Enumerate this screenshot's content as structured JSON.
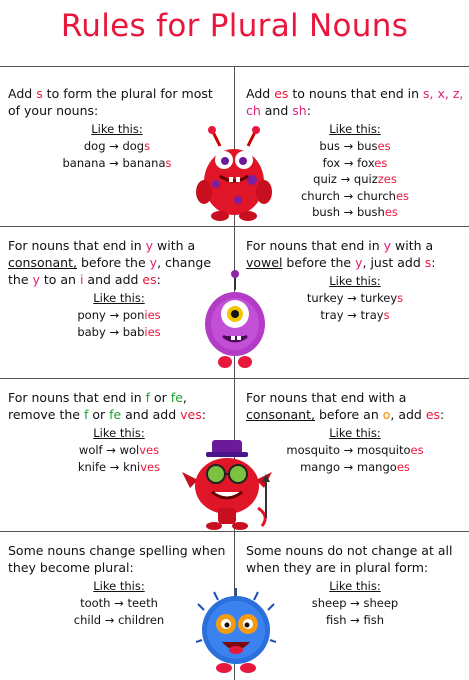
{
  "title": "Rules for Plural Nouns",
  "like_this": "Like this:",
  "arrow": "→",
  "rules": [
    {
      "intro": [
        {
          "t": "Add "
        },
        {
          "t": "s",
          "c": "red"
        },
        {
          "t": " to form the plural for most of your nouns:"
        }
      ],
      "examples": [
        {
          "base": "dog",
          "stem": "dog",
          "suffix": "s",
          "suffix_color": "red"
        },
        {
          "base": "banana",
          "stem": "banana",
          "suffix": "s",
          "suffix_color": "red"
        }
      ]
    },
    {
      "intro": [
        {
          "t": "Add "
        },
        {
          "t": "es",
          "c": "red"
        },
        {
          "t": " to nouns that end in "
        },
        {
          "t": "s, x, z, ch",
          "c": "pink"
        },
        {
          "t": " and "
        },
        {
          "t": "sh",
          "c": "pink"
        },
        {
          "t": ":"
        }
      ],
      "examples": [
        {
          "base": "bus",
          "stem": "bus",
          "suffix": "es",
          "suffix_color": "red"
        },
        {
          "base": "fox",
          "stem": "fox",
          "suffix": "es",
          "suffix_color": "red"
        },
        {
          "base": "quiz",
          "stem": "quiz",
          "suffix": "zes",
          "suffix_color": "red"
        },
        {
          "base": "church",
          "stem": "church",
          "suffix": "es",
          "suffix_color": "red"
        },
        {
          "base": "bush",
          "stem": "bush",
          "suffix": "es",
          "suffix_color": "red"
        }
      ]
    },
    {
      "intro": [
        {
          "t": "For nouns that end in "
        },
        {
          "t": "y",
          "c": "pink"
        },
        {
          "t": " with a "
        },
        {
          "t": "consonant,",
          "u": true
        },
        {
          "t": " before the "
        },
        {
          "t": "y",
          "c": "pink"
        },
        {
          "t": ", change the "
        },
        {
          "t": "y",
          "c": "pink"
        },
        {
          "t": " to an "
        },
        {
          "t": "i",
          "c": "pink"
        },
        {
          "t": " and add "
        },
        {
          "t": "es",
          "c": "red"
        },
        {
          "t": ":"
        }
      ],
      "examples": [
        {
          "base": "pony",
          "stem": "pon",
          "suffix": "ies",
          "suffix_color": "red"
        },
        {
          "base": "baby",
          "stem": "bab",
          "suffix": "ies",
          "suffix_color": "red"
        }
      ]
    },
    {
      "intro": [
        {
          "t": "For nouns that end in "
        },
        {
          "t": "y",
          "c": "pink"
        },
        {
          "t": " with a "
        },
        {
          "t": "vowel",
          "u": true
        },
        {
          "t": " before the "
        },
        {
          "t": "y",
          "c": "pink"
        },
        {
          "t": ", just add "
        },
        {
          "t": "s",
          "c": "red"
        },
        {
          "t": ":"
        }
      ],
      "examples": [
        {
          "base": "turkey",
          "stem": "turkey",
          "suffix": "s",
          "suffix_color": "red"
        },
        {
          "base": "tray",
          "stem": "tray",
          "suffix": "s",
          "suffix_color": "red"
        }
      ]
    },
    {
      "intro": [
        {
          "t": "For nouns that end in "
        },
        {
          "t": "f",
          "c": "green"
        },
        {
          "t": " or "
        },
        {
          "t": "fe",
          "c": "green"
        },
        {
          "t": ", remove the "
        },
        {
          "t": "f",
          "c": "green"
        },
        {
          "t": " or "
        },
        {
          "t": "fe",
          "c": "green"
        },
        {
          "t": " and add "
        },
        {
          "t": "ves",
          "c": "red"
        },
        {
          "t": ":"
        }
      ],
      "examples": [
        {
          "base": "wolf",
          "stem": "wol",
          "suffix": "ves",
          "suffix_color": "red"
        },
        {
          "base": "knife",
          "stem": "kni",
          "suffix": "ves",
          "suffix_color": "red"
        }
      ]
    },
    {
      "intro": [
        {
          "t": "For nouns that end with a "
        },
        {
          "t": "consonant,",
          "u": true
        },
        {
          "t": " before an "
        },
        {
          "t": "o",
          "c": "orange"
        },
        {
          "t": ", add "
        },
        {
          "t": "es",
          "c": "red"
        },
        {
          "t": ":"
        }
      ],
      "examples": [
        {
          "base": "mosquito",
          "stem": "mosquito",
          "suffix": "es",
          "suffix_color": "red"
        },
        {
          "base": "mango",
          "stem": "mango",
          "suffix": "es",
          "suffix_color": "red"
        }
      ]
    },
    {
      "intro": [
        {
          "t": "Some nouns change spelling when they become plural:"
        }
      ],
      "examples": [
        {
          "base": "tooth",
          "stem": "teeth",
          "suffix": "",
          "suffix_color": ""
        },
        {
          "base": "child",
          "stem": "children",
          "suffix": "",
          "suffix_color": ""
        }
      ]
    },
    {
      "intro": [
        {
          "t": "Some nouns do not change at all when they are in plural form:"
        }
      ],
      "examples": [
        {
          "base": "sheep",
          "stem": "sheep",
          "suffix": "",
          "suffix_color": ""
        },
        {
          "base": "fish",
          "stem": "fish",
          "suffix": "",
          "suffix_color": ""
        }
      ]
    }
  ]
}
